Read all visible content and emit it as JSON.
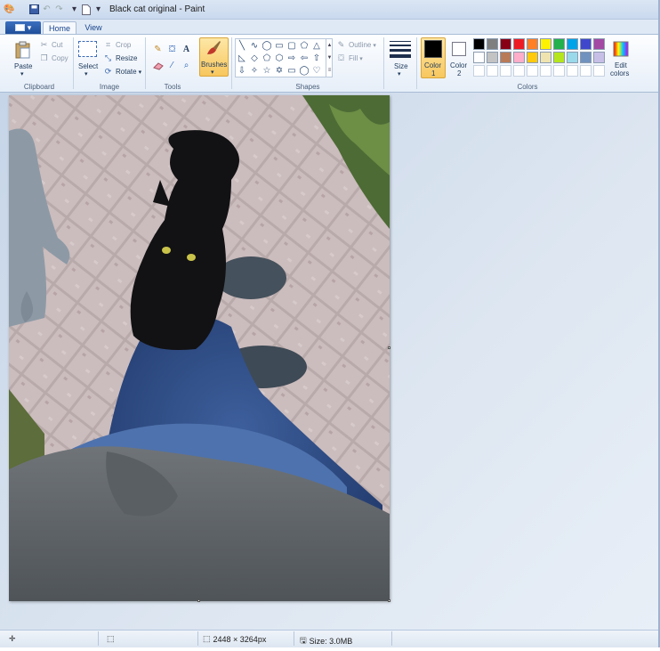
{
  "window": {
    "title": "Black cat original - Paint"
  },
  "tabs": {
    "home": "Home",
    "view": "View"
  },
  "clipboard": {
    "group": "Clipboard",
    "paste": "Paste",
    "cut": "Cut",
    "copy": "Copy"
  },
  "image": {
    "group": "Image",
    "select": "Select",
    "crop": "Crop",
    "resize": "Resize",
    "rotate": "Rotate"
  },
  "tools": {
    "group": "Tools",
    "brushes": "Brushes"
  },
  "shapes": {
    "group": "Shapes",
    "outline": "Outline",
    "fill": "Fill"
  },
  "size": {
    "label": "Size"
  },
  "colors": {
    "group": "Colors",
    "color1": "Color\n1",
    "color1_line1": "Color",
    "color1_line2": "1",
    "color2_line1": "Color",
    "color2_line2": "2",
    "edit_line1": "Edit",
    "edit_line2": "colors",
    "color1_value": "#000000",
    "color2_value": "#ffffff",
    "palette_row1": [
      "#000000",
      "#7f7f7f",
      "#880015",
      "#ed1c24",
      "#ff7f27",
      "#fff200",
      "#22b14c",
      "#00a2e8",
      "#3f48cc",
      "#a349a4"
    ],
    "palette_row2": [
      "#ffffff",
      "#c3c3c3",
      "#b97a57",
      "#ffaec9",
      "#ffc90e",
      "#efe4b0",
      "#b5e61d",
      "#99d9ea",
      "#7092be",
      "#c8bfe7"
    ]
  },
  "status": {
    "dimensions": "2448 × 3264px",
    "size": "Size: 3.0MB"
  }
}
